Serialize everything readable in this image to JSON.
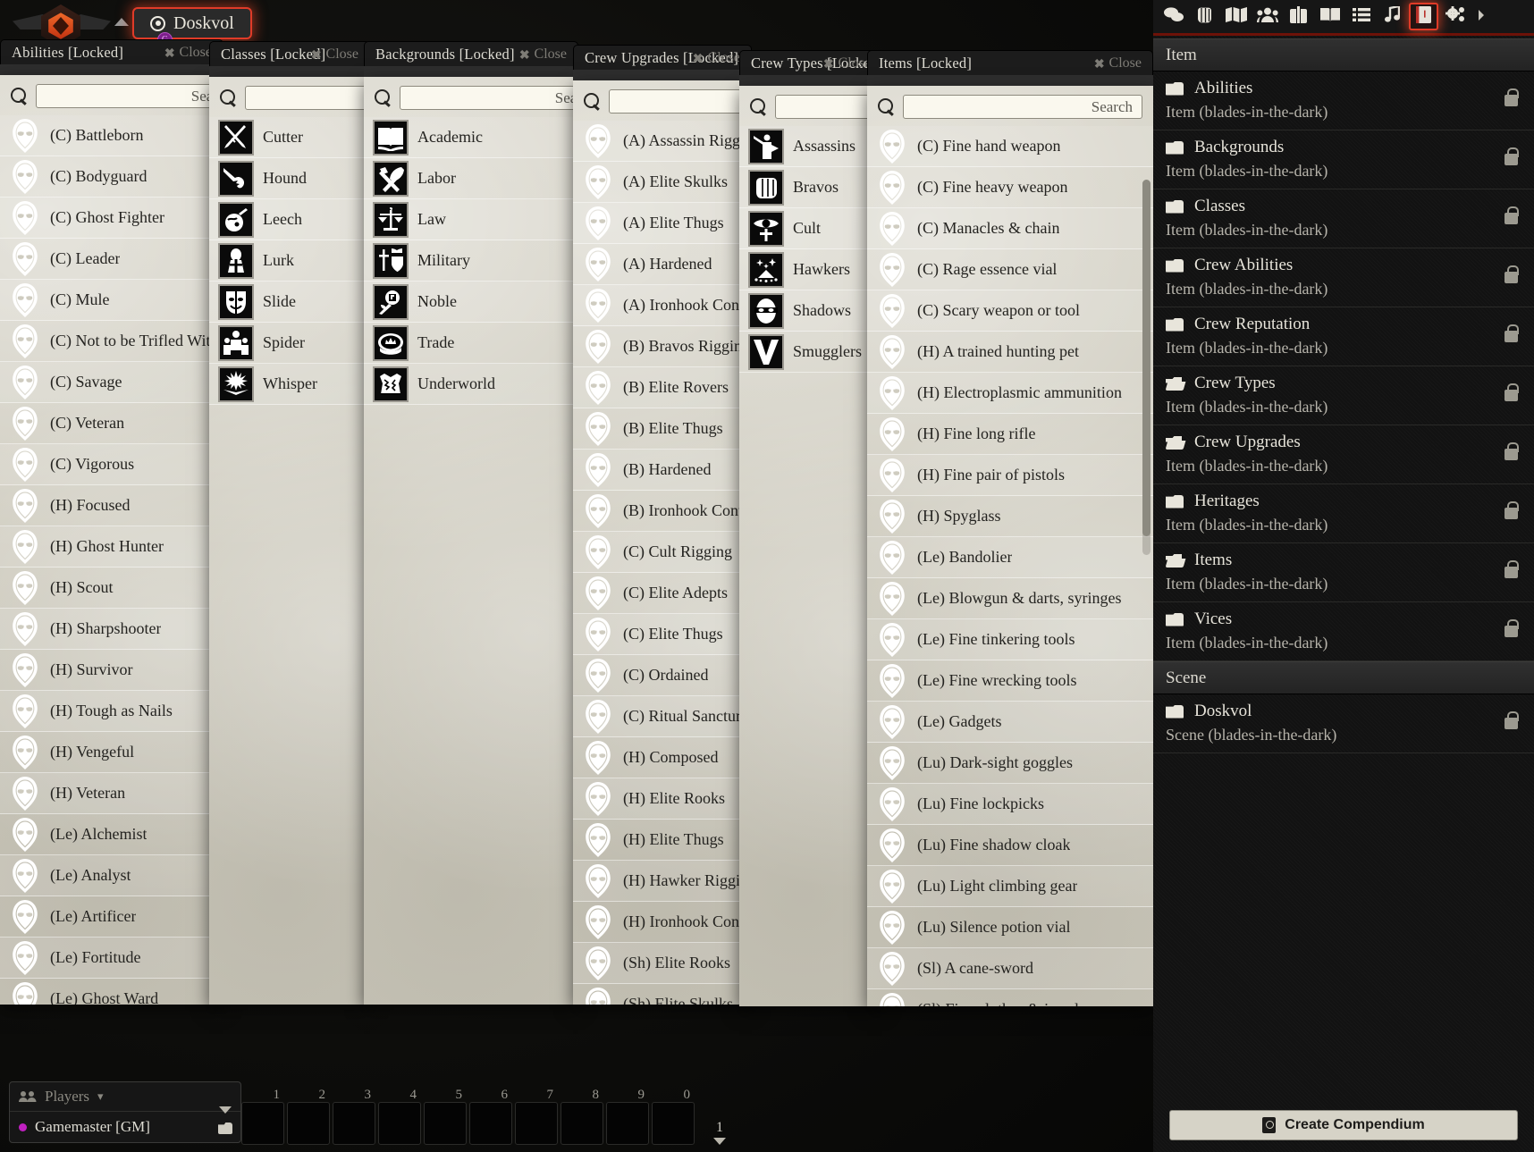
{
  "app": {
    "logo_name": "foundry-vtt-logo",
    "scene_tab_label": "Doskvol",
    "scene_badge": "G"
  },
  "search": {
    "placeholder": "Search"
  },
  "common": {
    "close_label": "Close",
    "locked_suffix": "[Locked]"
  },
  "windows": [
    {
      "id": "abilities",
      "title": "Abilities [Locked]",
      "icon_style": "hood",
      "entries": [
        "(C) Battleborn",
        "(C) Bodyguard",
        "(C) Ghost Fighter",
        "(C) Leader",
        "(C) Mule",
        "(C) Not to be Trifled With",
        "(C) Savage",
        "(C) Veteran",
        "(C) Vigorous",
        "(H) Focused",
        "(H) Ghost Hunter",
        "(H) Scout",
        "(H) Sharpshooter",
        "(H) Survivor",
        "(H) Tough as Nails",
        "(H) Vengeful",
        "(H) Veteran",
        "(Le) Alchemist",
        "(Le) Analyst",
        "(Le) Artificer",
        "(Le) Fortitude",
        "(Le) Ghost Ward"
      ]
    },
    {
      "id": "classes",
      "title": "Classes [Locked]",
      "icon_style": "art",
      "entries": [
        {
          "label": "Cutter",
          "icon": "crossed-swords-icon"
        },
        {
          "label": "Hound",
          "icon": "hound-dart-icon"
        },
        {
          "label": "Leech",
          "icon": "alchemy-flask-icon"
        },
        {
          "label": "Lurk",
          "icon": "cloaked-figure-icon"
        },
        {
          "label": "Slide",
          "icon": "theater-mask-icon"
        },
        {
          "label": "Spider",
          "icon": "crowd-figures-icon"
        },
        {
          "label": "Whisper",
          "icon": "open-book-burst-icon"
        }
      ]
    },
    {
      "id": "backgrounds",
      "title": "Backgrounds [Locked]",
      "icon_style": "art",
      "entries": [
        {
          "label": "Academic",
          "icon": "open-book-icon"
        },
        {
          "label": "Labor",
          "icon": "hammer-pick-icon"
        },
        {
          "label": "Law",
          "icon": "scales-icon"
        },
        {
          "label": "Military",
          "icon": "sword-shield-icon"
        },
        {
          "label": "Noble",
          "icon": "rose-icon"
        },
        {
          "label": "Trade",
          "icon": "coin-icon"
        },
        {
          "label": "Underworld",
          "icon": "torn-cloth-icon"
        }
      ]
    },
    {
      "id": "crew-upgrades",
      "title": "Crew Upgrades [Locked]",
      "icon_style": "hood",
      "entries": [
        "(A) Assassin Rigging",
        "(A) Elite Skulks",
        "(A) Elite Thugs",
        "(A) Hardened",
        "(A) Ironhook Contacts",
        "(B) Bravos Rigging",
        "(B) Elite Rovers",
        "(B) Elite Thugs",
        "(B) Hardened",
        "(B) Ironhook Contacts",
        "(C) Cult Rigging",
        "(C) Elite Adepts",
        "(C) Elite Thugs",
        "(C) Ordained",
        "(C) Ritual Sanctum in",
        "(H) Composed",
        "(H) Elite Rooks",
        "(H) Elite Thugs",
        "(H) Hawker Rigging",
        "(H) Ironhook Contacts",
        "(Sh) Elite Rooks",
        "(Sh) Elite Skulks"
      ]
    },
    {
      "id": "crew-types",
      "title": "Crew Types [Locked]",
      "icon_style": "art",
      "entries": [
        {
          "label": "Assassins",
          "icon": "assassin-figure-icon"
        },
        {
          "label": "Bravos",
          "icon": "fist-icon"
        },
        {
          "label": "Cult",
          "icon": "occult-eye-icon"
        },
        {
          "label": "Hawkers",
          "icon": "powder-sparkle-icon"
        },
        {
          "label": "Shadows",
          "icon": "masked-face-icon"
        },
        {
          "label": "Smugglers",
          "icon": "anchor-vee-icon"
        }
      ]
    },
    {
      "id": "items",
      "title": "Items [Locked]",
      "icon_style": "hood",
      "entries": [
        "(C) Fine hand weapon",
        "(C) Fine heavy weapon",
        "(C) Manacles & chain",
        "(C) Rage essence vial",
        "(C) Scary weapon or tool",
        "(H) A trained hunting pet",
        "(H) Electroplasmic ammunition",
        "(H) Fine long rifle",
        "(H) Fine pair of pistols",
        "(H) Spyglass",
        "(Le) Bandolier",
        "(Le) Blowgun & darts, syringes",
        "(Le) Fine tinkering tools",
        "(Le) Fine wrecking tools",
        "(Le) Gadgets",
        "(Lu) Dark-sight goggles",
        "(Lu) Fine lockpicks",
        "(Lu) Fine shadow cloak",
        "(Lu) Light climbing gear",
        "(Lu) Silence potion vial",
        "(Sl) A cane-sword",
        "(Sl) Fine clothes & jewelry"
      ]
    }
  ],
  "players": {
    "header_label": "Players",
    "rows": [
      {
        "name": "Gamemaster [GM]",
        "color": "#c020c0"
      }
    ]
  },
  "hotbar": {
    "slots": [
      "1",
      "2",
      "3",
      "4",
      "5",
      "6",
      "7",
      "8",
      "9",
      "0"
    ],
    "page": "1"
  },
  "sidebar": {
    "tabs": [
      {
        "name": "chat-bubble-icon",
        "active": false
      },
      {
        "name": "combat-fist-icon",
        "active": false
      },
      {
        "name": "scenes-map-icon",
        "active": false
      },
      {
        "name": "actors-group-icon",
        "active": false
      },
      {
        "name": "items-bag-icon",
        "active": false
      },
      {
        "name": "journal-book-icon",
        "active": false
      },
      {
        "name": "tables-list-icon",
        "active": false
      },
      {
        "name": "playlists-note-icon",
        "active": false
      },
      {
        "name": "compendium-icon",
        "active": true
      },
      {
        "name": "settings-gears-icon",
        "active": false
      },
      {
        "name": "more-chevron-icon",
        "active": false
      }
    ],
    "groups": [
      {
        "label": "Item",
        "packs": [
          {
            "name": "Abilities",
            "subtitle": "Item (blades-in-the-dark)",
            "open": false,
            "locked": true
          },
          {
            "name": "Backgrounds",
            "subtitle": "Item (blades-in-the-dark)",
            "open": false,
            "locked": true
          },
          {
            "name": "Classes",
            "subtitle": "Item (blades-in-the-dark)",
            "open": false,
            "locked": true
          },
          {
            "name": "Crew Abilities",
            "subtitle": "Item (blades-in-the-dark)",
            "open": false,
            "locked": true
          },
          {
            "name": "Crew Reputation",
            "subtitle": "Item (blades-in-the-dark)",
            "open": false,
            "locked": true
          },
          {
            "name": "Crew Types",
            "subtitle": "Item (blades-in-the-dark)",
            "open": true,
            "locked": true
          },
          {
            "name": "Crew Upgrades",
            "subtitle": "Item (blades-in-the-dark)",
            "open": true,
            "locked": true
          },
          {
            "name": "Heritages",
            "subtitle": "Item (blades-in-the-dark)",
            "open": false,
            "locked": true
          },
          {
            "name": "Items",
            "subtitle": "Item (blades-in-the-dark)",
            "open": true,
            "locked": true
          },
          {
            "name": "Vices",
            "subtitle": "Item (blades-in-the-dark)",
            "open": false,
            "locked": true
          }
        ]
      },
      {
        "label": "Scene",
        "packs": [
          {
            "name": "Doskvol",
            "subtitle": "Scene (blades-in-the-dark)",
            "open": false,
            "locked": true
          }
        ]
      }
    ],
    "create_button_label": "Create Compendium"
  }
}
